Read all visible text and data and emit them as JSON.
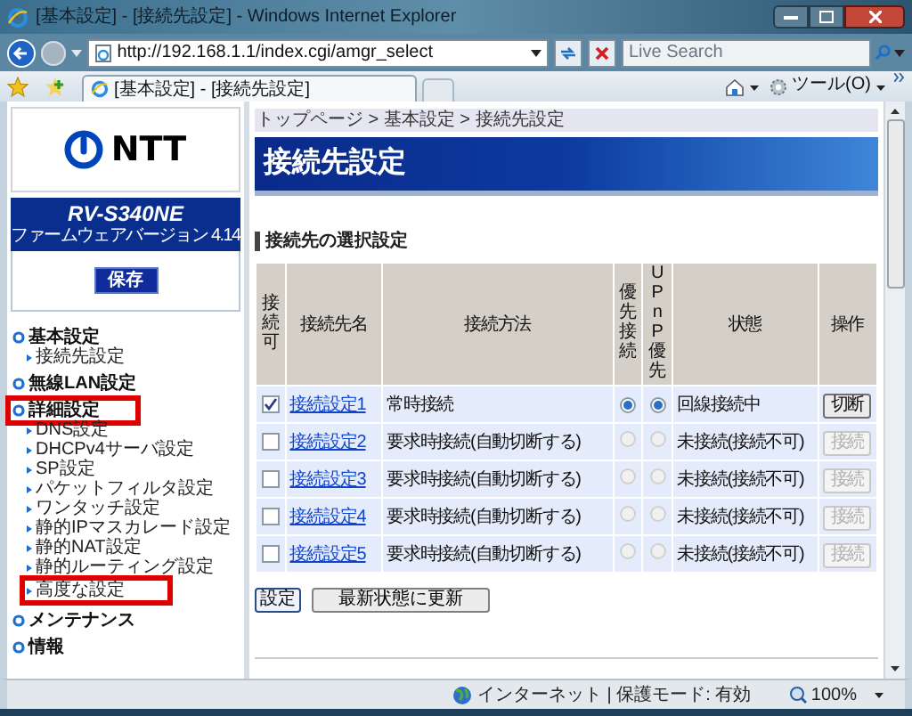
{
  "window": {
    "title": "[基本設定] - [接続先設定] - Windows Internet Explorer"
  },
  "browser": {
    "address": "http://192.168.1.1/index.cgi/amgr_select",
    "search_placeholder": "Live Search",
    "tab": {
      "title": "[基本設定] - [接続先設定]",
      "selected": true
    },
    "tools_menu": "ツール(O)"
  },
  "sidebar": {
    "logo": "NTT",
    "model": "RV-S340NE",
    "firmware": "ファームウェアバージョン 4.14",
    "save_button": "保存",
    "menu": [
      {
        "label": "基本設定",
        "highlighted": false,
        "children": [
          {
            "label": "接続先設定",
            "highlighted": false
          }
        ]
      },
      {
        "label": "無線LAN設定",
        "highlighted": false
      },
      {
        "label": "詳細設定",
        "highlighted": true,
        "children": [
          {
            "label": "DNS設定",
            "highlighted": false
          },
          {
            "label": "DHCPv4サーバ設定",
            "highlighted": false
          },
          {
            "label": "SP設定",
            "highlighted": false
          },
          {
            "label": "パケットフィルタ設定",
            "highlighted": false
          },
          {
            "label": "ワンタッチ設定",
            "highlighted": false
          },
          {
            "label": "静的IPマスカレード設定",
            "highlighted": false
          },
          {
            "label": "静的NAT設定",
            "highlighted": false
          },
          {
            "label": "静的ルーティング設定",
            "highlighted": false
          },
          {
            "label": "高度な設定",
            "highlighted": true
          }
        ]
      },
      {
        "label": "メンテナンス",
        "highlighted": false
      },
      {
        "label": "情報",
        "highlighted": false
      }
    ]
  },
  "main": {
    "breadcrumb": "トップページ > 基本設定 > 接続先設定",
    "page_title": "接続先設定",
    "section_title": "接続先の選択設定",
    "table": {
      "columns": [
        {
          "label": "接続可",
          "vertical": true
        },
        {
          "label": "接続先名",
          "vertical": false
        },
        {
          "label": "接続方法",
          "vertical": false
        },
        {
          "label": "優先接続",
          "vertical": true
        },
        {
          "label": "UPnP優先",
          "vertical": true
        },
        {
          "label": "状態",
          "vertical": false
        },
        {
          "label": "操作",
          "vertical": false
        }
      ],
      "rows": [
        {
          "enabled": true,
          "name": "接続設定1",
          "method": "常時接続",
          "priority": {
            "selected": true,
            "disabled": false
          },
          "upnp": {
            "selected": true,
            "disabled": false
          },
          "status": "回線接続中",
          "action": {
            "label": "切断",
            "disabled": false
          }
        },
        {
          "enabled": false,
          "name": "接続設定2",
          "method": "要求時接続(自動切断する)",
          "priority": {
            "selected": false,
            "disabled": true
          },
          "upnp": {
            "selected": false,
            "disabled": true
          },
          "status": "未接続(接続不可)",
          "action": {
            "label": "接続",
            "disabled": true
          }
        },
        {
          "enabled": false,
          "name": "接続設定3",
          "method": "要求時接続(自動切断する)",
          "priority": {
            "selected": false,
            "disabled": true
          },
          "upnp": {
            "selected": false,
            "disabled": true
          },
          "status": "未接続(接続不可)",
          "action": {
            "label": "接続",
            "disabled": true
          }
        },
        {
          "enabled": false,
          "name": "接続設定4",
          "method": "要求時接続(自動切断する)",
          "priority": {
            "selected": false,
            "disabled": true
          },
          "upnp": {
            "selected": false,
            "disabled": true
          },
          "status": "未接続(接続不可)",
          "action": {
            "label": "接続",
            "disabled": true
          }
        },
        {
          "enabled": false,
          "name": "接続設定5",
          "method": "要求時接続(自動切断する)",
          "priority": {
            "selected": false,
            "disabled": true
          },
          "upnp": {
            "selected": false,
            "disabled": true
          },
          "status": "未接続(接続不可)",
          "action": {
            "label": "接続",
            "disabled": true
          }
        }
      ]
    },
    "buttons": [
      "設定",
      "最新状態に更新"
    ]
  },
  "status_bar": {
    "zone": "インターネット | 保護モード: 有効",
    "zoom": "100%"
  }
}
